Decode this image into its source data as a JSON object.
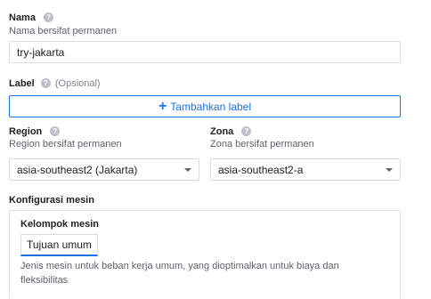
{
  "name": {
    "label": "Nama",
    "helper": "Nama bersifat permanen",
    "value": "try-jakarta",
    "help_icon": "?"
  },
  "labels": {
    "label": "Label",
    "optional": "(Opsional)",
    "add_button": "Tambahkan label",
    "add_icon": "+",
    "help_icon": "?"
  },
  "region": {
    "label": "Region",
    "helper": "Region bersifat permanen",
    "value": "asia-southeast2 (Jakarta)",
    "help_icon": "?"
  },
  "zone": {
    "label": "Zona",
    "helper": "Zona bersifat permanen",
    "value": "asia-southeast2-a",
    "help_icon": "?"
  },
  "machine_config": {
    "title": "Konfigurasi mesin",
    "family_label": "Kelompok mesin",
    "family_selected": "Tujuan umum",
    "description": "Jenis mesin untuk beban kerja umum, yang dioptimalkan untuk biaya dan fleksibilitas"
  },
  "colors": {
    "accent": "#1a73e8",
    "border": "#dadce0",
    "helper_text": "#5f6368"
  }
}
